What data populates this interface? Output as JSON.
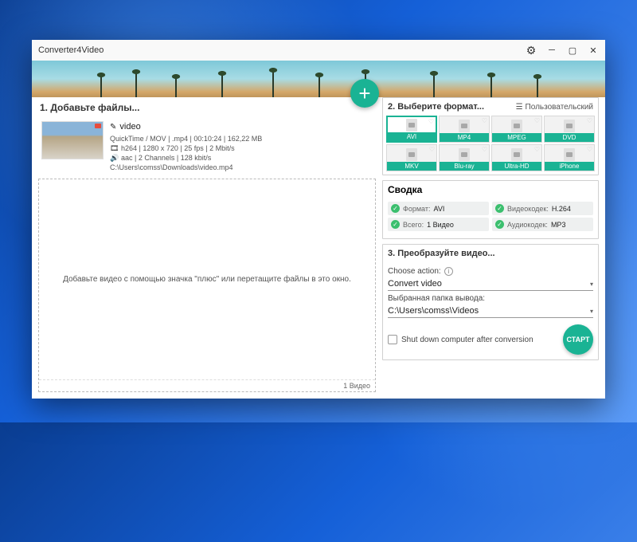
{
  "title": "Converter4Video",
  "step1": {
    "title": "1. Добавьте файлы...",
    "dropzone_msg": "Добавьте видео с помощью значка \"плюс\" или перетащите файлы в это окно.",
    "footer": "1 Видео"
  },
  "file": {
    "name": "video",
    "line1": "QuickTime / MOV | .mp4 | 00:10:24 | 162,22 MB",
    "line2": "h264 | 1280 x 720 | 25 fps | 2 Mbit/s",
    "line3": "aac | 2 Channels | 128 kbit/s",
    "path": "C:\\Users\\comss\\Downloads\\video.mp4"
  },
  "step2": {
    "title": "2. Выберите формат...",
    "custom": "Пользовательский",
    "formats": [
      "AVI",
      "MP4",
      "MPEG",
      "DVD",
      "MKV",
      "Blu-ray",
      "Ultra-HD",
      "iPhone"
    ]
  },
  "summary": {
    "title": "Сводка",
    "format_k": "Формат:",
    "format_v": "AVI",
    "vcodec_k": "Видеокодек:",
    "vcodec_v": "H.264",
    "total_k": "Всего:",
    "total_v": "1 Видео",
    "acodec_k": "Аудиокодек:",
    "acodec_v": "MP3"
  },
  "step3": {
    "title": "3. Преобразуйте видео...",
    "action_label": "Choose action:",
    "action_value": "Convert video",
    "output_label": "Выбранная папка вывода:",
    "output_value": "C:\\Users\\comss\\Videos",
    "shutdown": "Shut down computer after conversion",
    "start": "СТАРТ"
  }
}
